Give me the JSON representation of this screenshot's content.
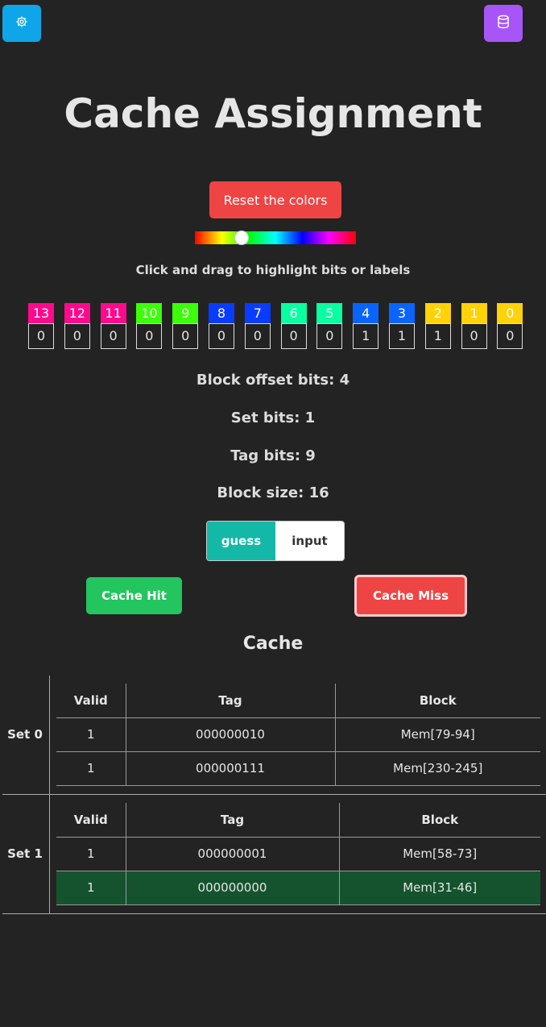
{
  "header": {
    "settings_icon": "gear-icon",
    "database_icon": "database-icon"
  },
  "title": "Cache Assignment",
  "reset_label": "Reset the colors",
  "hint": "Click and drag to highlight bits or labels",
  "bits": [
    {
      "label": "13",
      "value": "0",
      "color": "#ff0a8c"
    },
    {
      "label": "12",
      "value": "0",
      "color": "#ff0a8c"
    },
    {
      "label": "11",
      "value": "0",
      "color": "#ff0a8c"
    },
    {
      "label": "10",
      "value": "0",
      "color": "#3cff0a"
    },
    {
      "label": "9",
      "value": "0",
      "color": "#3cff0a"
    },
    {
      "label": "8",
      "value": "0",
      "color": "#0a3cff"
    },
    {
      "label": "7",
      "value": "0",
      "color": "#0a3cff"
    },
    {
      "label": "6",
      "value": "0",
      "color": "#0affa0"
    },
    {
      "label": "5",
      "value": "0",
      "color": "#0affa0"
    },
    {
      "label": "4",
      "value": "1",
      "color": "#0a64ff"
    },
    {
      "label": "3",
      "value": "1",
      "color": "#0a64ff"
    },
    {
      "label": "2",
      "value": "1",
      "color": "#ffd20a"
    },
    {
      "label": "1",
      "value": "0",
      "color": "#ffd20a"
    },
    {
      "label": "0",
      "value": "0",
      "color": "#ffd20a"
    }
  ],
  "info": {
    "block_offset": "Block offset bits: 4",
    "set_bits": "Set bits: 1",
    "tag_bits": "Tag bits: 9",
    "block_size": "Block size: 16"
  },
  "mode_toggle": {
    "guess": "guess",
    "input": "input"
  },
  "buttons": {
    "hit": "Cache Hit",
    "miss": "Cache Miss"
  },
  "cache_title": "Cache",
  "cache": {
    "columns": [
      "Valid",
      "Tag",
      "Block"
    ],
    "sets": [
      {
        "label": "Set 0",
        "rows": [
          {
            "valid": "1",
            "tag": "000000010",
            "block": "Mem[79-94]"
          },
          {
            "valid": "1",
            "tag": "000000111",
            "block": "Mem[230-245]"
          }
        ]
      },
      {
        "label": "Set 1",
        "rows": [
          {
            "valid": "1",
            "tag": "000000001",
            "block": "Mem[58-73]"
          },
          {
            "valid": "1",
            "tag": "000000000",
            "block": "Mem[31-46]",
            "highlighted": true
          }
        ]
      }
    ]
  }
}
